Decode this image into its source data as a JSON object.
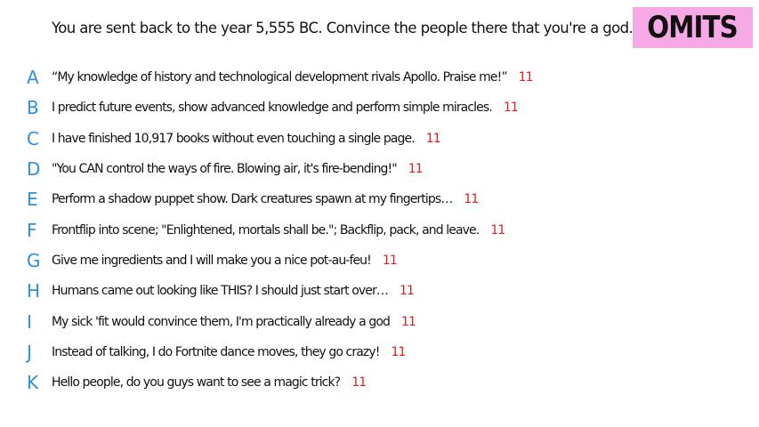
{
  "prompt": "You are sent back to the year 5,555 BC. Convince the people there that you're a god.",
  "badge": "OMITS",
  "colors": {
    "letter": "#2f8fdc",
    "score": "#e01e1e",
    "badge_background": "#f7a9e6",
    "text": "#111111"
  },
  "answers": [
    {
      "letter": "A",
      "text": "“My knowledge of history and technological development rivals Apollo. Praise me!”",
      "score": "11"
    },
    {
      "letter": "B",
      "text": "I predict future events, show advanced knowledge and perform simple miracles.",
      "score": "11"
    },
    {
      "letter": "C",
      "text": "I have finished 10,917 books without even touching a single page.",
      "score": "11"
    },
    {
      "letter": "D",
      "text": "\"You CAN control the ways of fire. Blowing air, it's fire-bending!\"",
      "score": "11"
    },
    {
      "letter": "E",
      "text": "Perform a shadow puppet show. Dark creatures spawn at my fingertips…",
      "score": "11"
    },
    {
      "letter": "F",
      "text": "Frontflip into scene; \"Enlightened, mortals shall be.\"; Backflip, pack, and leave.",
      "score": "11"
    },
    {
      "letter": "G",
      "text": "Give me ingredients and I will make you a nice pot-au-feu!",
      "score": "11"
    },
    {
      "letter": "H",
      "text": "Humans came out looking like THIS? I should just start over…",
      "score": "11"
    },
    {
      "letter": "I",
      "text": "My sick 'fit would convince them, I'm practically already a god",
      "score": "11"
    },
    {
      "letter": "J",
      "text": "Instead of talking, I do Fortnite dance moves, they go crazy!",
      "score": "11"
    },
    {
      "letter": "K",
      "text": "Hello people, do you guys want to see a magic trick?",
      "score": "11"
    }
  ]
}
